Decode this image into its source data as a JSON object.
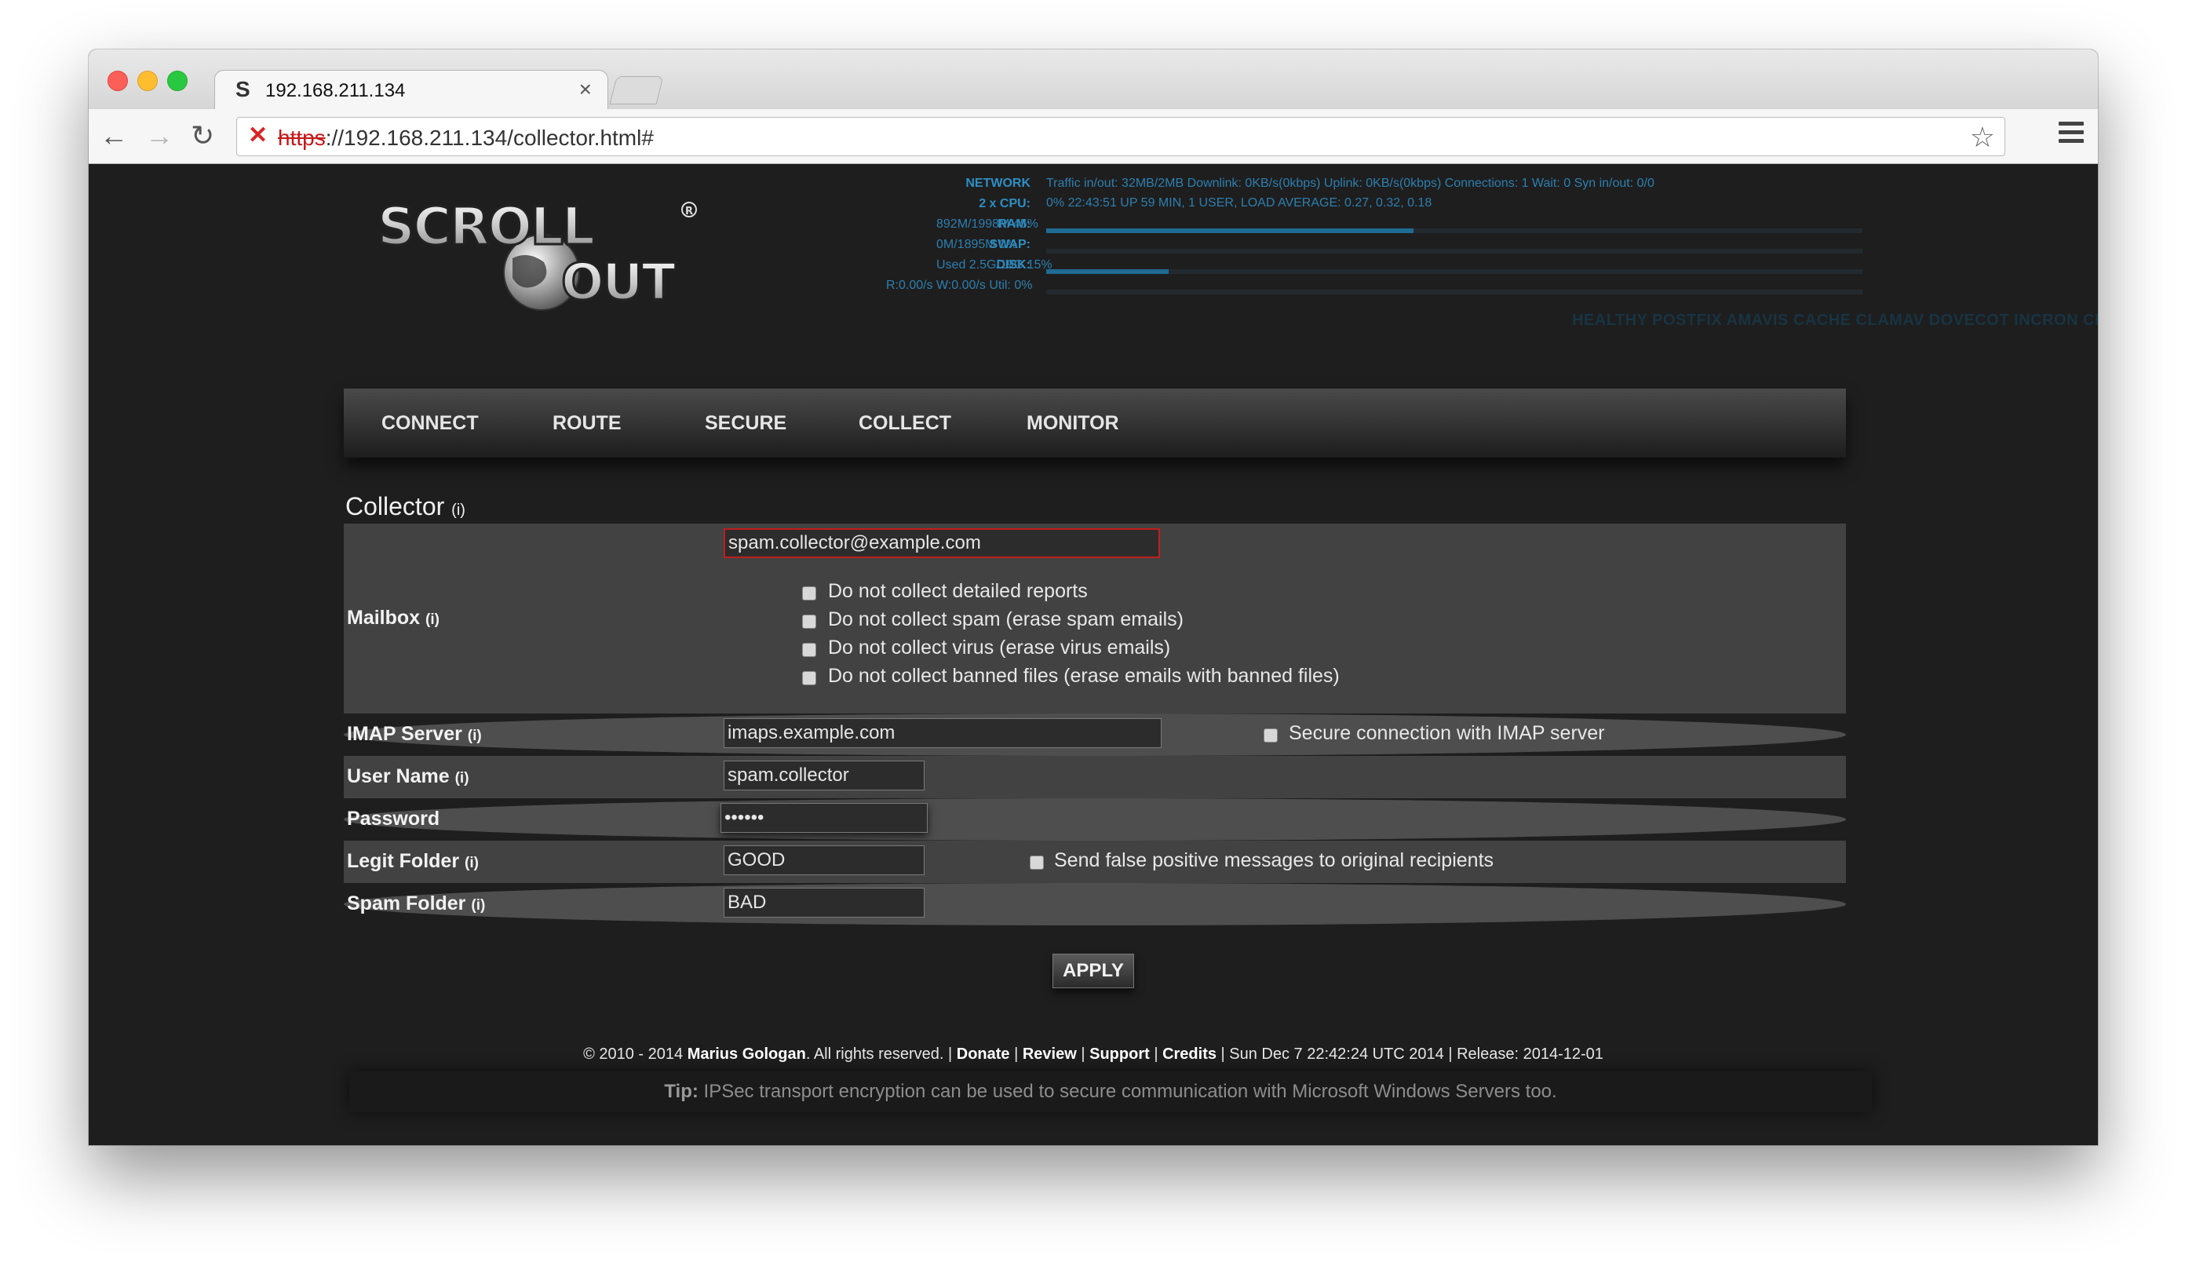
{
  "browser": {
    "tab_title": "192.168.211.134",
    "tab_close": "×",
    "favicon": "S",
    "url_protocol": "https",
    "url_rest": "://192.168.211.134/collector.html#",
    "back": "←",
    "forward": "→",
    "reload": "↻",
    "star": "☆",
    "insecure": "✕"
  },
  "stats": {
    "network_label": "NETWORK",
    "network_value": "Traffic in/out: 32MB/2MB  Downlink: 0KB/s(0kbps)  Uplink: 0KB/s(0kbps)  Connections: 1  Wait: 0  Syn in/out: 0/0",
    "cpu_label": "2 x CPU:",
    "cpu_value": "0%   22:43:51 UP 59 MIN, 1 USER, LOAD AVERAGE: 0.27, 0.32, 0.18",
    "ram_label": "RAM:",
    "ram_value": "892M/1998M 45%",
    "ram_fraction": 0.45,
    "swap_label": "SWAP:",
    "swap_value": "0M/1895M 0%",
    "disk_label": "DISK:",
    "disk_value": "Used 2.5G/19G 15%",
    "disk_fraction": 0.15,
    "io_value": "R:0.00/s W:0.00/s Util: 0%",
    "services": "HEALTHY  POSTFIX AMAVIS CACHE CLAMAV DOVECOT INCRON CRON FIREWALL REBOOT"
  },
  "logo": {
    "word1": "SCROLL",
    "word2": "OUT",
    "registered": "R"
  },
  "nav": [
    "CONNECT",
    "ROUTE",
    "SECURE",
    "COLLECT",
    "MONITOR"
  ],
  "section": {
    "title": "Collector",
    "info": "(i)"
  },
  "form": {
    "mailbox_label": "Mailbox",
    "mailbox_value": "spam.collector@example.com",
    "checks": [
      "Do not collect detailed reports",
      "Do not collect spam (erase spam emails)",
      "Do not collect virus (erase virus emails)",
      "Do not collect banned files (erase emails with banned files)"
    ],
    "imap_label": "IMAP Server",
    "imap_value": "imaps.example.com",
    "imap_secure": "Secure connection with IMAP server",
    "user_label": "User Name",
    "user_value": "spam.collector",
    "password_label": "Password",
    "password_value": "••••••",
    "legit_label": "Legit Folder",
    "legit_value": "GOOD",
    "legit_check": "Send false positive messages to original recipients",
    "spam_label": "Spam Folder",
    "spam_value": "BAD",
    "info": "(i)"
  },
  "apply_label": "APPLY",
  "footer": {
    "prefix": "© 2010 - 2014 ",
    "author": "Marius Gologan",
    "rights": ". All rights reserved. | ",
    "donate": "Donate",
    "sep1": " | ",
    "review": "Review",
    "sep2": " | ",
    "support": "Support",
    "sep3": " | ",
    "credits": "Credits",
    "date": " | Sun Dec 7 22:42:24 UTC 2014 | Release: 2014-12-01"
  },
  "tip": {
    "label": "Tip:",
    "text": " IPSec transport encryption can be used to secure communication with Microsoft Windows Servers too."
  }
}
